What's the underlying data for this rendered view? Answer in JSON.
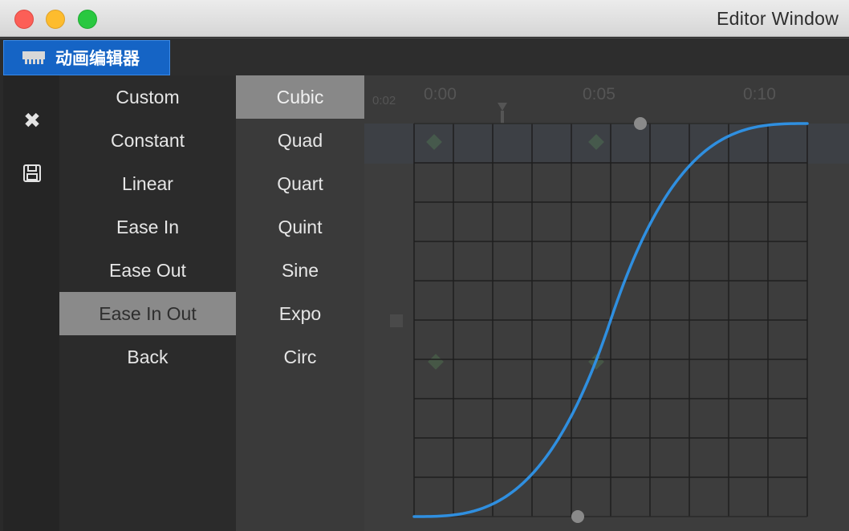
{
  "window": {
    "title": "Editor Window",
    "controls": [
      "close",
      "minimize",
      "maximize"
    ]
  },
  "tab": {
    "label": "动画编辑器",
    "icon": "panel-icon",
    "color": "#1564c5"
  },
  "toolbar": {
    "buttons": [
      {
        "name": "close",
        "icon": "close-icon",
        "glyph": "✖"
      },
      {
        "name": "save",
        "icon": "save-icon",
        "glyph": ""
      }
    ]
  },
  "presets": {
    "items": [
      "Custom",
      "Constant",
      "Linear",
      "Ease In",
      "Ease Out",
      "Ease In Out",
      "Back"
    ],
    "selected": "Ease In Out"
  },
  "curve_types": {
    "items": [
      "Cubic",
      "Quad",
      "Quart",
      "Quint",
      "Sine",
      "Expo",
      "Circ"
    ],
    "selected": "Cubic"
  },
  "timeline": {
    "time_labels": [
      "0:02",
      "0:00",
      "0:05",
      "0:10"
    ]
  },
  "curve": {
    "easing": "easeInOutCubic",
    "color": "#2f8fe0",
    "grid_color": "#1e1e1e"
  }
}
